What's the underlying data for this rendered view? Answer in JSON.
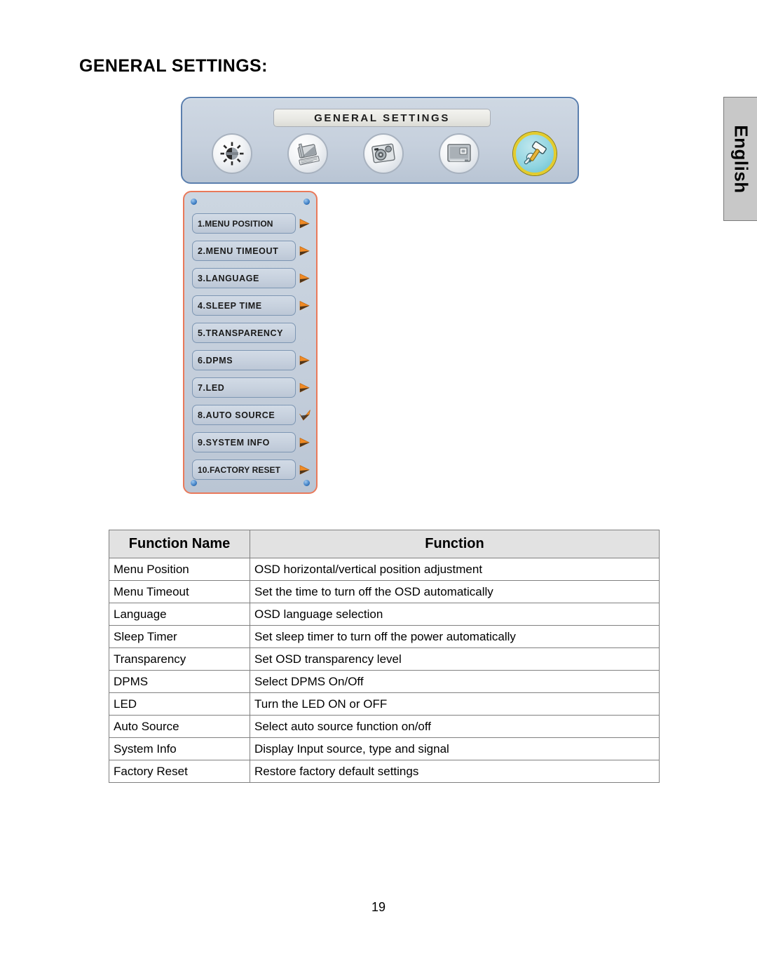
{
  "page": {
    "title": "GENERAL SETTINGS:",
    "number": "19",
    "language_tab": "English"
  },
  "osd": {
    "bar_title": "GENERAL SETTINGS",
    "category_icons": [
      {
        "name": "brightness-contrast-icon",
        "selected": false
      },
      {
        "name": "image-adjust-icon",
        "selected": false
      },
      {
        "name": "color-adjust-icon",
        "selected": false
      },
      {
        "name": "display-screen-icon",
        "selected": false
      },
      {
        "name": "tools-settings-icon",
        "selected": true
      }
    ],
    "menu_items": [
      {
        "label": "1.MENU POSITION",
        "marker": "arrow"
      },
      {
        "label": "2.MENU TIMEOUT",
        "marker": "arrow"
      },
      {
        "label": "3.LANGUAGE",
        "marker": "arrow"
      },
      {
        "label": "4.SLEEP TIME",
        "marker": "arrow"
      },
      {
        "label": "5.TRANSPARENCY",
        "marker": "none"
      },
      {
        "label": "6.DPMS",
        "marker": "arrow"
      },
      {
        "label": "7.LED",
        "marker": "arrow"
      },
      {
        "label": "8.AUTO SOURCE",
        "marker": "check"
      },
      {
        "label": "9.SYSTEM INFO",
        "marker": "arrow"
      },
      {
        "label": "10.FACTORY RESET",
        "marker": "arrow"
      }
    ]
  },
  "table": {
    "headers": [
      "Function Name",
      "Function"
    ],
    "rows": [
      [
        "Menu Position",
        "OSD horizontal/vertical position adjustment"
      ],
      [
        "Menu Timeout",
        "Set the time to turn off the OSD automatically"
      ],
      [
        "Language",
        "OSD language selection"
      ],
      [
        "Sleep Timer",
        "Set sleep timer to turn off the power automatically"
      ],
      [
        "Transparency",
        "Set OSD transparency level"
      ],
      [
        "DPMS",
        "Select DPMS On/Off"
      ],
      [
        "LED",
        "Turn the LED ON or OFF"
      ],
      [
        "Auto Source",
        "Select auto source function on/off"
      ],
      [
        "System Info",
        "Display Input source, type and signal"
      ],
      [
        "Factory Reset",
        "Restore factory default settings"
      ]
    ]
  },
  "colors": {
    "osd_panel_border": "#e9795a",
    "osd_bar_border": "#5b7fae",
    "osd_background": "#c6d0dd",
    "selected_icon_ring": "#e3cc2e",
    "marker_orange": "#f08a24",
    "table_header_bg": "#e2e2e2"
  }
}
